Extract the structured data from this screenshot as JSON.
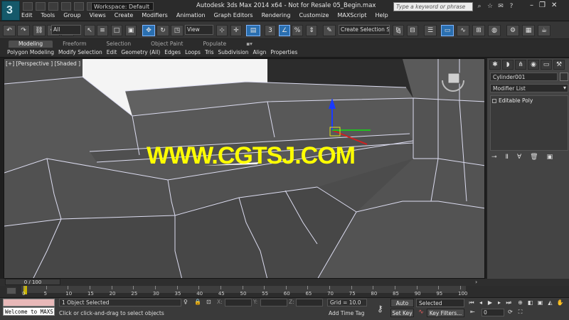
{
  "app": {
    "logo_label": "3",
    "workspace": "Workspace: Default",
    "title": "Autodesk 3ds Max  2014 x64  - Not for Resale   05_Begin.max",
    "search_placeholder": "Type a keyword or phrase",
    "window_controls": [
      "–",
      "❐",
      "✕"
    ]
  },
  "menu": [
    "Edit",
    "Tools",
    "Group",
    "Views",
    "Create",
    "Modifiers",
    "Animation",
    "Graph Editors",
    "Rendering",
    "Customize",
    "MAXScript",
    "Help"
  ],
  "toolbar": {
    "selection_filter": "All",
    "reference_coord": "View",
    "named_selection": "Create Selection Se"
  },
  "ribbon": {
    "tabs": [
      "Modeling",
      "Freeform",
      "Selection",
      "Object Paint",
      "Populate"
    ],
    "active_tab": "Modeling",
    "subtabs": [
      "Polygon Modeling",
      "Modify Selection",
      "Edit",
      "Geometry (All)",
      "Edges",
      "Loops",
      "Tris",
      "Subdivision",
      "Align",
      "Properties"
    ]
  },
  "viewport": {
    "label": "[+] [Perspective ] [Shaded ]",
    "watermark": "WWW.CGTSJ.COM"
  },
  "command_panel": {
    "object_name": "Cylinder001",
    "modifier_list": "Modifier List",
    "stack_item": "Editable Poly"
  },
  "timeline": {
    "slider": "0 / 100",
    "ticks": [
      "0",
      "5",
      "10",
      "15",
      "20",
      "25",
      "30",
      "35",
      "40",
      "45",
      "50",
      "55",
      "60",
      "65",
      "70",
      "75",
      "80",
      "85",
      "90",
      "95",
      "100"
    ]
  },
  "status": {
    "maxscript_listener": "Welcome to MAXS",
    "selection_count": "1 Object Selected",
    "prompt": "Click or click-and-drag to select objects",
    "x_label": "X:",
    "y_label": "Y:",
    "z_label": "Z:",
    "grid": "Grid = 10.0",
    "add_time_tag": "Add Time Tag",
    "auto_key": "Auto Key",
    "set_key": "Set Key",
    "selected_set": "Selected",
    "key_filters": "Key Filters...",
    "frame": "0"
  }
}
